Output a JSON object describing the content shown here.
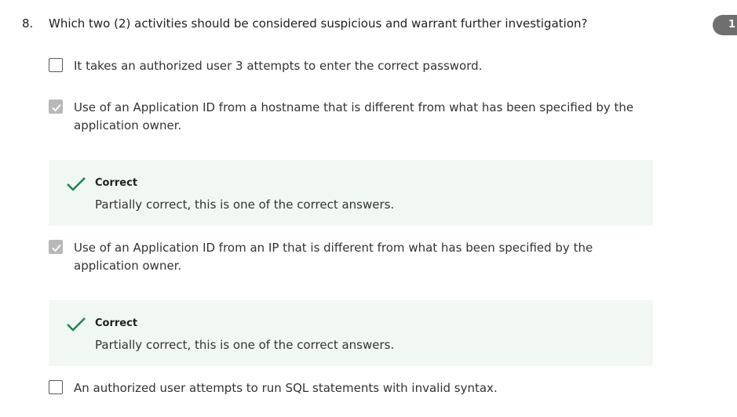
{
  "question": {
    "number": "8.",
    "text": "Which two (2) activities should be considered suspicious and warrant further investigation?",
    "points_badge": "1"
  },
  "options": [
    {
      "label": "It takes an authorized user 3 attempts to enter the correct password.",
      "checked": false
    },
    {
      "label": "Use of an Application ID from a hostname that is different from what has been specified by the application owner.",
      "checked": true
    },
    {
      "label": "Use of an Application ID from an IP that is different from what has been specified by the application owner.",
      "checked": true
    },
    {
      "label": "An authorized user attempts to run SQL statements with invalid syntax.",
      "checked": false
    }
  ],
  "feedback": [
    {
      "title": "Correct",
      "text": "Partially correct, this is one of the correct answers."
    },
    {
      "title": "Correct",
      "text": "Partially correct, this is one of the correct answers."
    }
  ],
  "colors": {
    "feedback_bg": "#f1f8f4",
    "check_green": "#1f8354",
    "checkbox_checked": "#b8b8b8",
    "badge_bg": "#6f6f6f"
  },
  "icons": {
    "feedback": "checkmark-icon",
    "checkbox_checked": "check-icon"
  }
}
